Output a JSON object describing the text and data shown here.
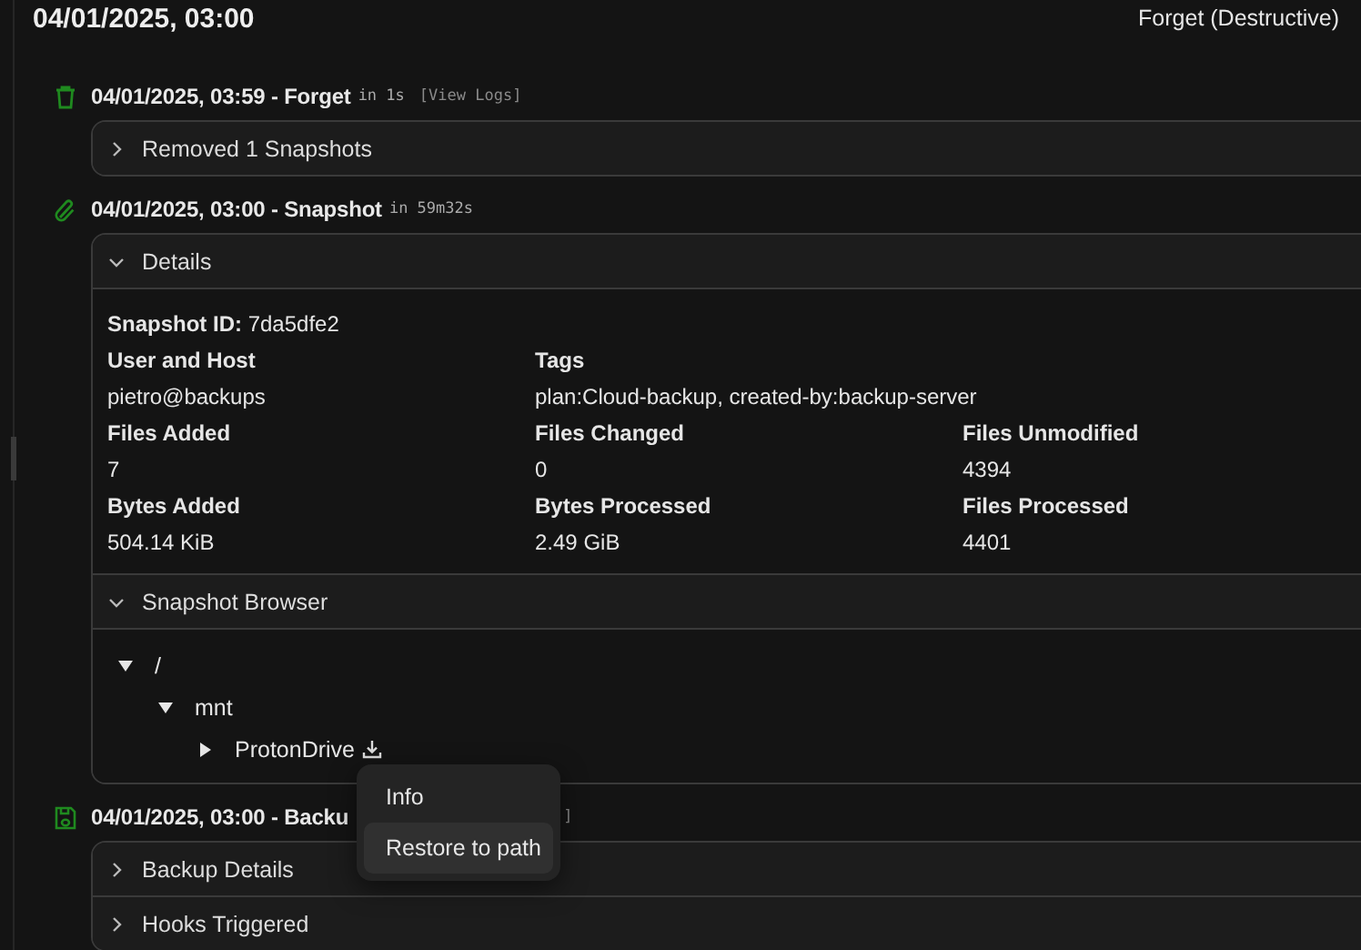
{
  "header": {
    "title": "04/01/2025, 03:00",
    "tag": "Forget (Destructive)"
  },
  "operations": [
    {
      "kind": "forget",
      "title": "04/01/2025, 03:59 - Forget",
      "duration": "in 1s",
      "link": "[View Logs]",
      "panels": [
        {
          "kind": "plain",
          "label": "Removed 1 Snapshots",
          "expanded": false
        }
      ]
    },
    {
      "kind": "snapshot",
      "title": "04/01/2025, 03:00 - Snapshot",
      "duration": "in 59m32s",
      "panels": [
        {
          "kind": "details",
          "label": "Details",
          "expanded": true,
          "id_label": "Snapshot ID:",
          "id_value": "7da5dfe2",
          "field_rows": [
            [
              {
                "label": "User and Host",
                "value": "pietro@backups"
              },
              {
                "label": "Tags",
                "value": "plan:Cloud-backup, created-by:backup-server"
              }
            ],
            [
              {
                "label": "Files Added",
                "value": "7"
              },
              {
                "label": "Files Changed",
                "value": "0"
              },
              {
                "label": "Files Unmodified",
                "value": "4394"
              }
            ],
            [
              {
                "label": "Bytes Added",
                "value": "504.14 KiB"
              },
              {
                "label": "Bytes Processed",
                "value": "2.49 GiB"
              },
              {
                "label": "Files Processed",
                "value": "4401"
              }
            ]
          ]
        },
        {
          "kind": "browser",
          "label": "Snapshot Browser",
          "expanded": true,
          "tree": [
            {
              "name": "/",
              "expanded": true,
              "children": [
                {
                  "name": "mnt",
                  "expanded": true,
                  "children": [
                    {
                      "name": "ProtonDrive",
                      "expanded": false,
                      "download": true
                    }
                  ]
                }
              ]
            }
          ]
        }
      ]
    },
    {
      "kind": "backup",
      "title": "04/01/2025, 03:00 - Backu",
      "link": "]",
      "panels": [
        {
          "kind": "plain",
          "label": "Backup Details",
          "expanded": false
        },
        {
          "kind": "plain",
          "label": "Hooks Triggered",
          "expanded": false
        }
      ]
    }
  ],
  "context_menu": {
    "items": [
      {
        "label": "Info",
        "selected": false
      },
      {
        "label": "Restore to path",
        "selected": true
      }
    ]
  }
}
